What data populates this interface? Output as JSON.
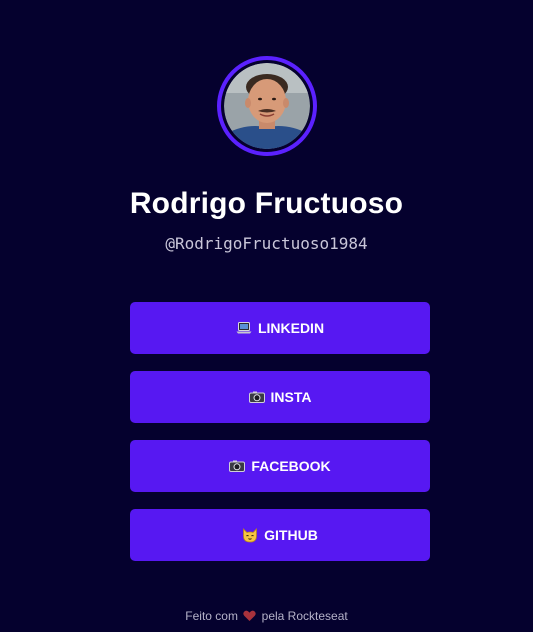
{
  "profile": {
    "name": "Rodrigo Fructuoso",
    "handle": "@RodrigoFructuoso1984"
  },
  "links": [
    {
      "icon": "laptop-icon",
      "label": "LINKEDIN"
    },
    {
      "icon": "camera-icon",
      "label": "INSTA"
    },
    {
      "icon": "camera-icon",
      "label": "FACEBOOK"
    },
    {
      "icon": "cat-icon",
      "label": "GITHUB"
    }
  ],
  "footer": {
    "prefix": "Feito com",
    "icon": "heart-icon",
    "suffix": "pela Rockteseat"
  },
  "colors": {
    "background": "#05012e",
    "accent": "#5718f2",
    "ring": "#5b21ff"
  }
}
